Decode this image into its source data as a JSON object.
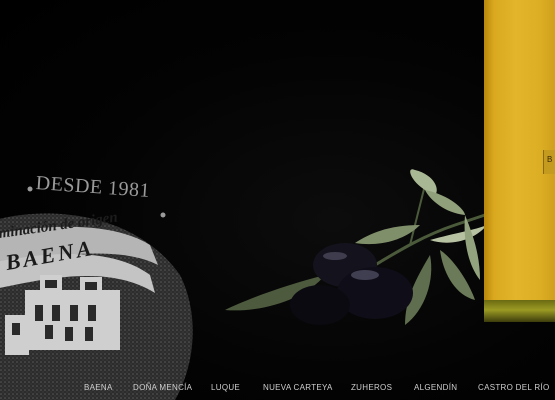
{
  "seal": {
    "top_text": "DESDE 1981",
    "middle_text": "minación de origen",
    "name": "BAENA"
  },
  "bottle": {
    "label_text": "B"
  },
  "nav": {
    "items": [
      {
        "label": "BAENA"
      },
      {
        "label": "DOÑA MENCÍA"
      },
      {
        "label": "LUQUE"
      },
      {
        "label": "NUEVA CARTEYA"
      },
      {
        "label": "ZUHEROS"
      },
      {
        "label": "ALGENDÍN"
      },
      {
        "label": "CASTRO DEL RÍO"
      }
    ]
  },
  "colors": {
    "background": "#000000",
    "oil": "#e2b52a",
    "nav_text": "#cfcfcf"
  }
}
